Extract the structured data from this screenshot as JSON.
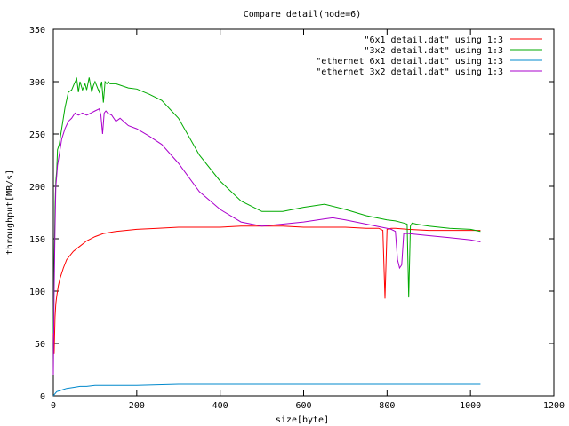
{
  "chart_data": {
    "type": "line",
    "title": "Compare detail(node=6)",
    "xlabel": "size[byte]",
    "ylabel": "throughput[MB/s]",
    "xlim": [
      0,
      1200
    ],
    "ylim": [
      0,
      350
    ],
    "xticks": [
      0,
      200,
      400,
      600,
      800,
      1000,
      1200
    ],
    "yticks": [
      0,
      50,
      100,
      150,
      200,
      250,
      300,
      350
    ],
    "grid": false,
    "legend_position": "top-right",
    "series": [
      {
        "name": "\"6x1 detail.dat\" using 1:3",
        "color": "#ff0000",
        "x": [
          0,
          2,
          4,
          6,
          8,
          12,
          16,
          24,
          32,
          48,
          64,
          80,
          100,
          120,
          150,
          200,
          250,
          300,
          350,
          400,
          450,
          500,
          550,
          600,
          650,
          700,
          750,
          780,
          790,
          795,
          800,
          810,
          820,
          850,
          900,
          950,
          1000,
          1024
        ],
        "y": [
          60,
          40,
          75,
          88,
          95,
          105,
          112,
          122,
          130,
          138,
          143,
          148,
          152,
          155,
          157,
          159,
          160,
          161,
          161,
          161,
          162,
          162,
          162,
          161,
          161,
          161,
          160,
          160,
          158,
          93,
          159,
          160,
          160,
          159,
          158,
          158,
          158,
          158
        ]
      },
      {
        "name": "\"3x2 detail.dat\" using 1:3",
        "color": "#00aa00",
        "x": [
          0,
          2,
          4,
          6,
          8,
          10,
          14,
          20,
          28,
          36,
          44,
          50,
          56,
          60,
          64,
          70,
          76,
          80,
          86,
          92,
          96,
          100,
          110,
          116,
          120,
          124,
          128,
          132,
          136,
          150,
          180,
          200,
          230,
          260,
          300,
          350,
          400,
          450,
          500,
          550,
          600,
          650,
          700,
          750,
          800,
          820,
          840,
          848,
          852,
          856,
          860,
          870,
          900,
          950,
          1000,
          1024
        ],
        "y": [
          60,
          120,
          180,
          205,
          215,
          235,
          240,
          255,
          275,
          290,
          292,
          298,
          303,
          290,
          300,
          292,
          298,
          292,
          304,
          290,
          296,
          300,
          290,
          300,
          280,
          300,
          298,
          300,
          298,
          298,
          294,
          293,
          288,
          282,
          265,
          230,
          205,
          186,
          176,
          176,
          180,
          183,
          178,
          172,
          168,
          167,
          165,
          164,
          94,
          162,
          165,
          164,
          162,
          160,
          159,
          157
        ]
      },
      {
        "name": "\"ethernet 6x1 detail.dat\" using 1:3",
        "color": "#0088cc",
        "x": [
          0,
          4,
          8,
          16,
          24,
          32,
          48,
          64,
          80,
          100,
          150,
          200,
          300,
          400,
          500,
          600,
          700,
          800,
          900,
          1000,
          1024
        ],
        "y": [
          0,
          2,
          4,
          5,
          6,
          7,
          8,
          9,
          9,
          10,
          10,
          10,
          11,
          11,
          11,
          11,
          11,
          11,
          11,
          11,
          11
        ]
      },
      {
        "name": "\"ethernet 3x2 detail.dat\" using 1:3",
        "color": "#aa00cc",
        "x": [
          0,
          2,
          4,
          6,
          8,
          10,
          14,
          20,
          28,
          36,
          44,
          52,
          60,
          70,
          80,
          90,
          100,
          110,
          114,
          118,
          122,
          126,
          130,
          140,
          150,
          160,
          180,
          200,
          230,
          260,
          300,
          350,
          400,
          450,
          500,
          550,
          600,
          650,
          670,
          700,
          750,
          800,
          810,
          820,
          825,
          830,
          835,
          840,
          850,
          900,
          950,
          1000,
          1024
        ],
        "y": [
          20,
          100,
          160,
          200,
          210,
          220,
          230,
          245,
          255,
          262,
          265,
          270,
          268,
          270,
          268,
          270,
          272,
          274,
          268,
          250,
          270,
          272,
          270,
          268,
          262,
          265,
          258,
          255,
          248,
          240,
          222,
          195,
          178,
          166,
          162,
          164,
          166,
          169,
          170,
          168,
          164,
          160,
          159,
          157,
          130,
          122,
          125,
          155,
          155,
          153,
          151,
          149,
          147
        ]
      }
    ]
  }
}
